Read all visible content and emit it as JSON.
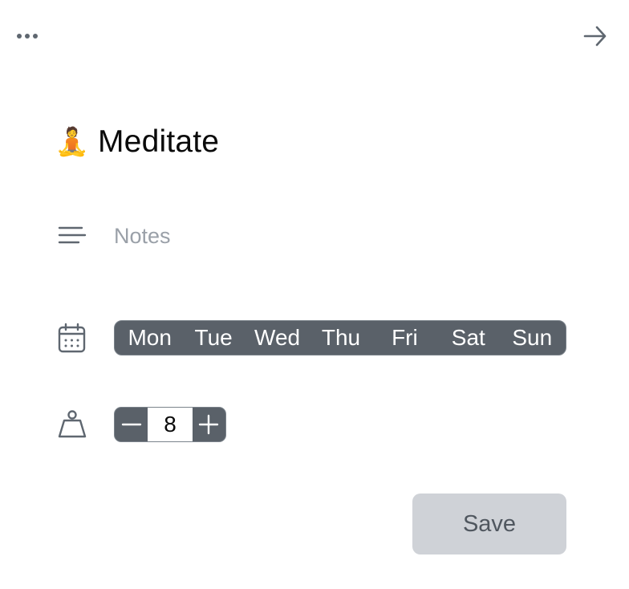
{
  "header": {
    "more_icon": "more-horizontal-icon",
    "next_icon": "arrow-right-icon"
  },
  "habit": {
    "emoji": "🧘",
    "title": "Meditate"
  },
  "notes": {
    "icon": "text-lines-icon",
    "placeholder": "Notes",
    "value": ""
  },
  "schedule": {
    "icon": "calendar-icon",
    "days": [
      {
        "label": "Mon",
        "selected": true
      },
      {
        "label": "Tue",
        "selected": true
      },
      {
        "label": "Wed",
        "selected": true
      },
      {
        "label": "Thu",
        "selected": true
      },
      {
        "label": "Fri",
        "selected": true
      },
      {
        "label": "Sat",
        "selected": true
      },
      {
        "label": "Sun",
        "selected": true
      }
    ]
  },
  "goal": {
    "icon": "weight-icon",
    "decrement_label": "−",
    "increment_label": "+",
    "value": "8"
  },
  "actions": {
    "save_label": "Save"
  },
  "colors": {
    "icon": "#5f6770",
    "segment_bg": "#5a6169",
    "save_bg": "#cfd2d7",
    "placeholder": "#9aa0a8"
  }
}
